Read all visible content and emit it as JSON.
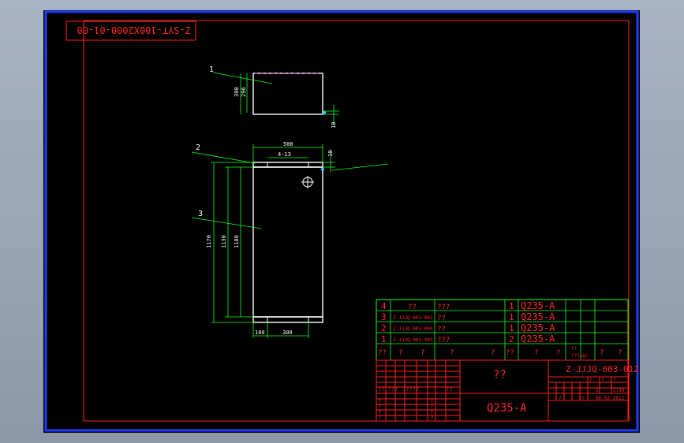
{
  "drawing": {
    "code_mirrored": "Z-SYT-100X2000-01-00",
    "drawing_no": "Z-JJJQ-003-012",
    "name": "??",
    "material": "Q235-A",
    "scale": "1:10",
    "qty_label": "1",
    "date": "06.02.2012",
    "weight_label": "??(kg)"
  },
  "balloons": {
    "b1": "1",
    "b2": "2",
    "b3": "3"
  },
  "dims": {
    "top_width": "500",
    "top_h1": "300",
    "top_h2": "296",
    "top_gap": "18",
    "main_width": "500",
    "main_holes": "4-13",
    "main_offset": "10",
    "overall_h": "1170",
    "mid_h": "1130",
    "inner_h": "1100",
    "bot_left": "100",
    "bot_right": "300"
  },
  "bom": [
    {
      "no": "4",
      "code": "??",
      "name": "???",
      "qty": "1",
      "mat": "Q235-A"
    },
    {
      "no": "3",
      "code": "Z-JJJQ-003-002",
      "name": "??",
      "qty": "1",
      "mat": "Q235-A"
    },
    {
      "no": "2",
      "code": "Z-JJJQ-003-004",
      "name": "??",
      "qty": "1",
      "mat": "Q235-A"
    },
    {
      "no": "1",
      "code": "Z-JJJQ-003-003",
      "name": "???",
      "qty": "2",
      "mat": "Q235-A"
    }
  ],
  "bom_header": [
    "??",
    "?",
    "?",
    "?",
    "?",
    "??",
    "?",
    "?",
    "??",
    "?",
    "?"
  ],
  "title_labels": {
    "design": "?? ???",
    "std": "?????",
    "sign": "??",
    "rows": [
      "?",
      "?",
      "?",
      "?"
    ],
    "side": [
      "?",
      "?",
      "?",
      "?"
    ],
    "weight_cols": [
      "?",
      "?",
      "?"
    ],
    "misc1": "?",
    "misc2": "??"
  }
}
